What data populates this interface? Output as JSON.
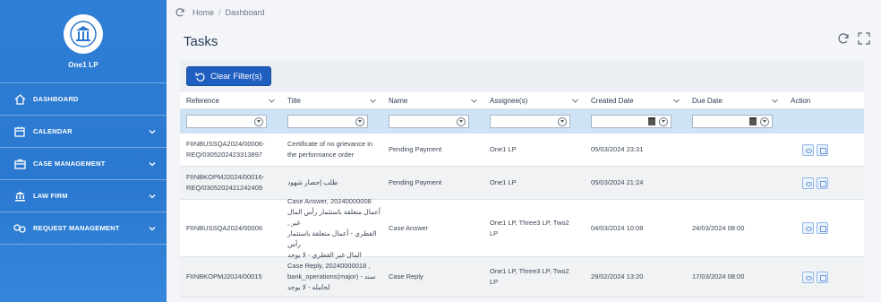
{
  "sidebar": {
    "brand": "One1 LP",
    "items": [
      {
        "label": "DASHBOARD",
        "icon": "home-icon",
        "has_children": false
      },
      {
        "label": "CALENDAR",
        "icon": "calendar-icon",
        "has_children": true
      },
      {
        "label": "CASE MANAGEMENT",
        "icon": "briefcase-icon",
        "has_children": true
      },
      {
        "label": "LAW FIRM",
        "icon": "bank-icon",
        "has_children": true
      },
      {
        "label": "REQUEST MANAGEMENT",
        "icon": "request-icon",
        "has_children": true
      }
    ]
  },
  "breadcrumb": {
    "home": "Home",
    "separator": "/",
    "current": "Dashboard"
  },
  "page": {
    "title": "Tasks"
  },
  "toolbar": {
    "clear_filters_label": "Clear Filter(s)"
  },
  "table": {
    "columns": [
      "Reference",
      "Title",
      "Name",
      "Assignee(s)",
      "Created Date",
      "Due Date",
      "Action"
    ],
    "rows": [
      {
        "reference": [
          "FIINBUSSQA2024/00006-",
          "REQ/0305202423313897"
        ],
        "title": [
          "Certificate of no grievance in",
          "the performance order"
        ],
        "name": "Pending Payment",
        "assignees": [
          "One1 LP"
        ],
        "created": "05/03/2024 23:31",
        "due": ""
      },
      {
        "reference": [
          "FIINBKOPMJ2024/00016-",
          "REQ/0305202421242409"
        ],
        "title": [
          "طلب إحضار شهود"
        ],
        "name": "Pending Payment",
        "assignees": [
          "One1 LP"
        ],
        "created": "05/03/2024 21:24",
        "due": ""
      },
      {
        "reference": [
          "FIINBUSSQA2024/00006"
        ],
        "title": [
          "Case Answer, 20240000008",
          "أعمال متعلقة باستثمار رأس المال غير ,",
          "القطري - أعمال متعلقة باستثمار رأس",
          "المال غير القطري - لا يوجد"
        ],
        "name": "Case Answer",
        "assignees": [
          "One1 LP, Three3 LP, Two2",
          "LP"
        ],
        "created": "04/03/2024 10:08",
        "due": "24/03/2024 08:00"
      },
      {
        "reference": [
          "FIINBKOPMJ2024/00015"
        ],
        "title": [
          "Case Reply, 20240000018 ,",
          "bank_operations(major) - سند",
          "لحامله - لا يوجد"
        ],
        "name": "Case Reply",
        "assignees": [
          "One1 LP, Three3 LP, Two2",
          "LP"
        ],
        "created": "29/02/2024 13:20",
        "due": "17/03/2024 08:00"
      }
    ]
  },
  "colors": {
    "sidebar": "#2f7fd6",
    "primary_button": "#1f5fbf",
    "filter_row": "#cfe3f6"
  }
}
